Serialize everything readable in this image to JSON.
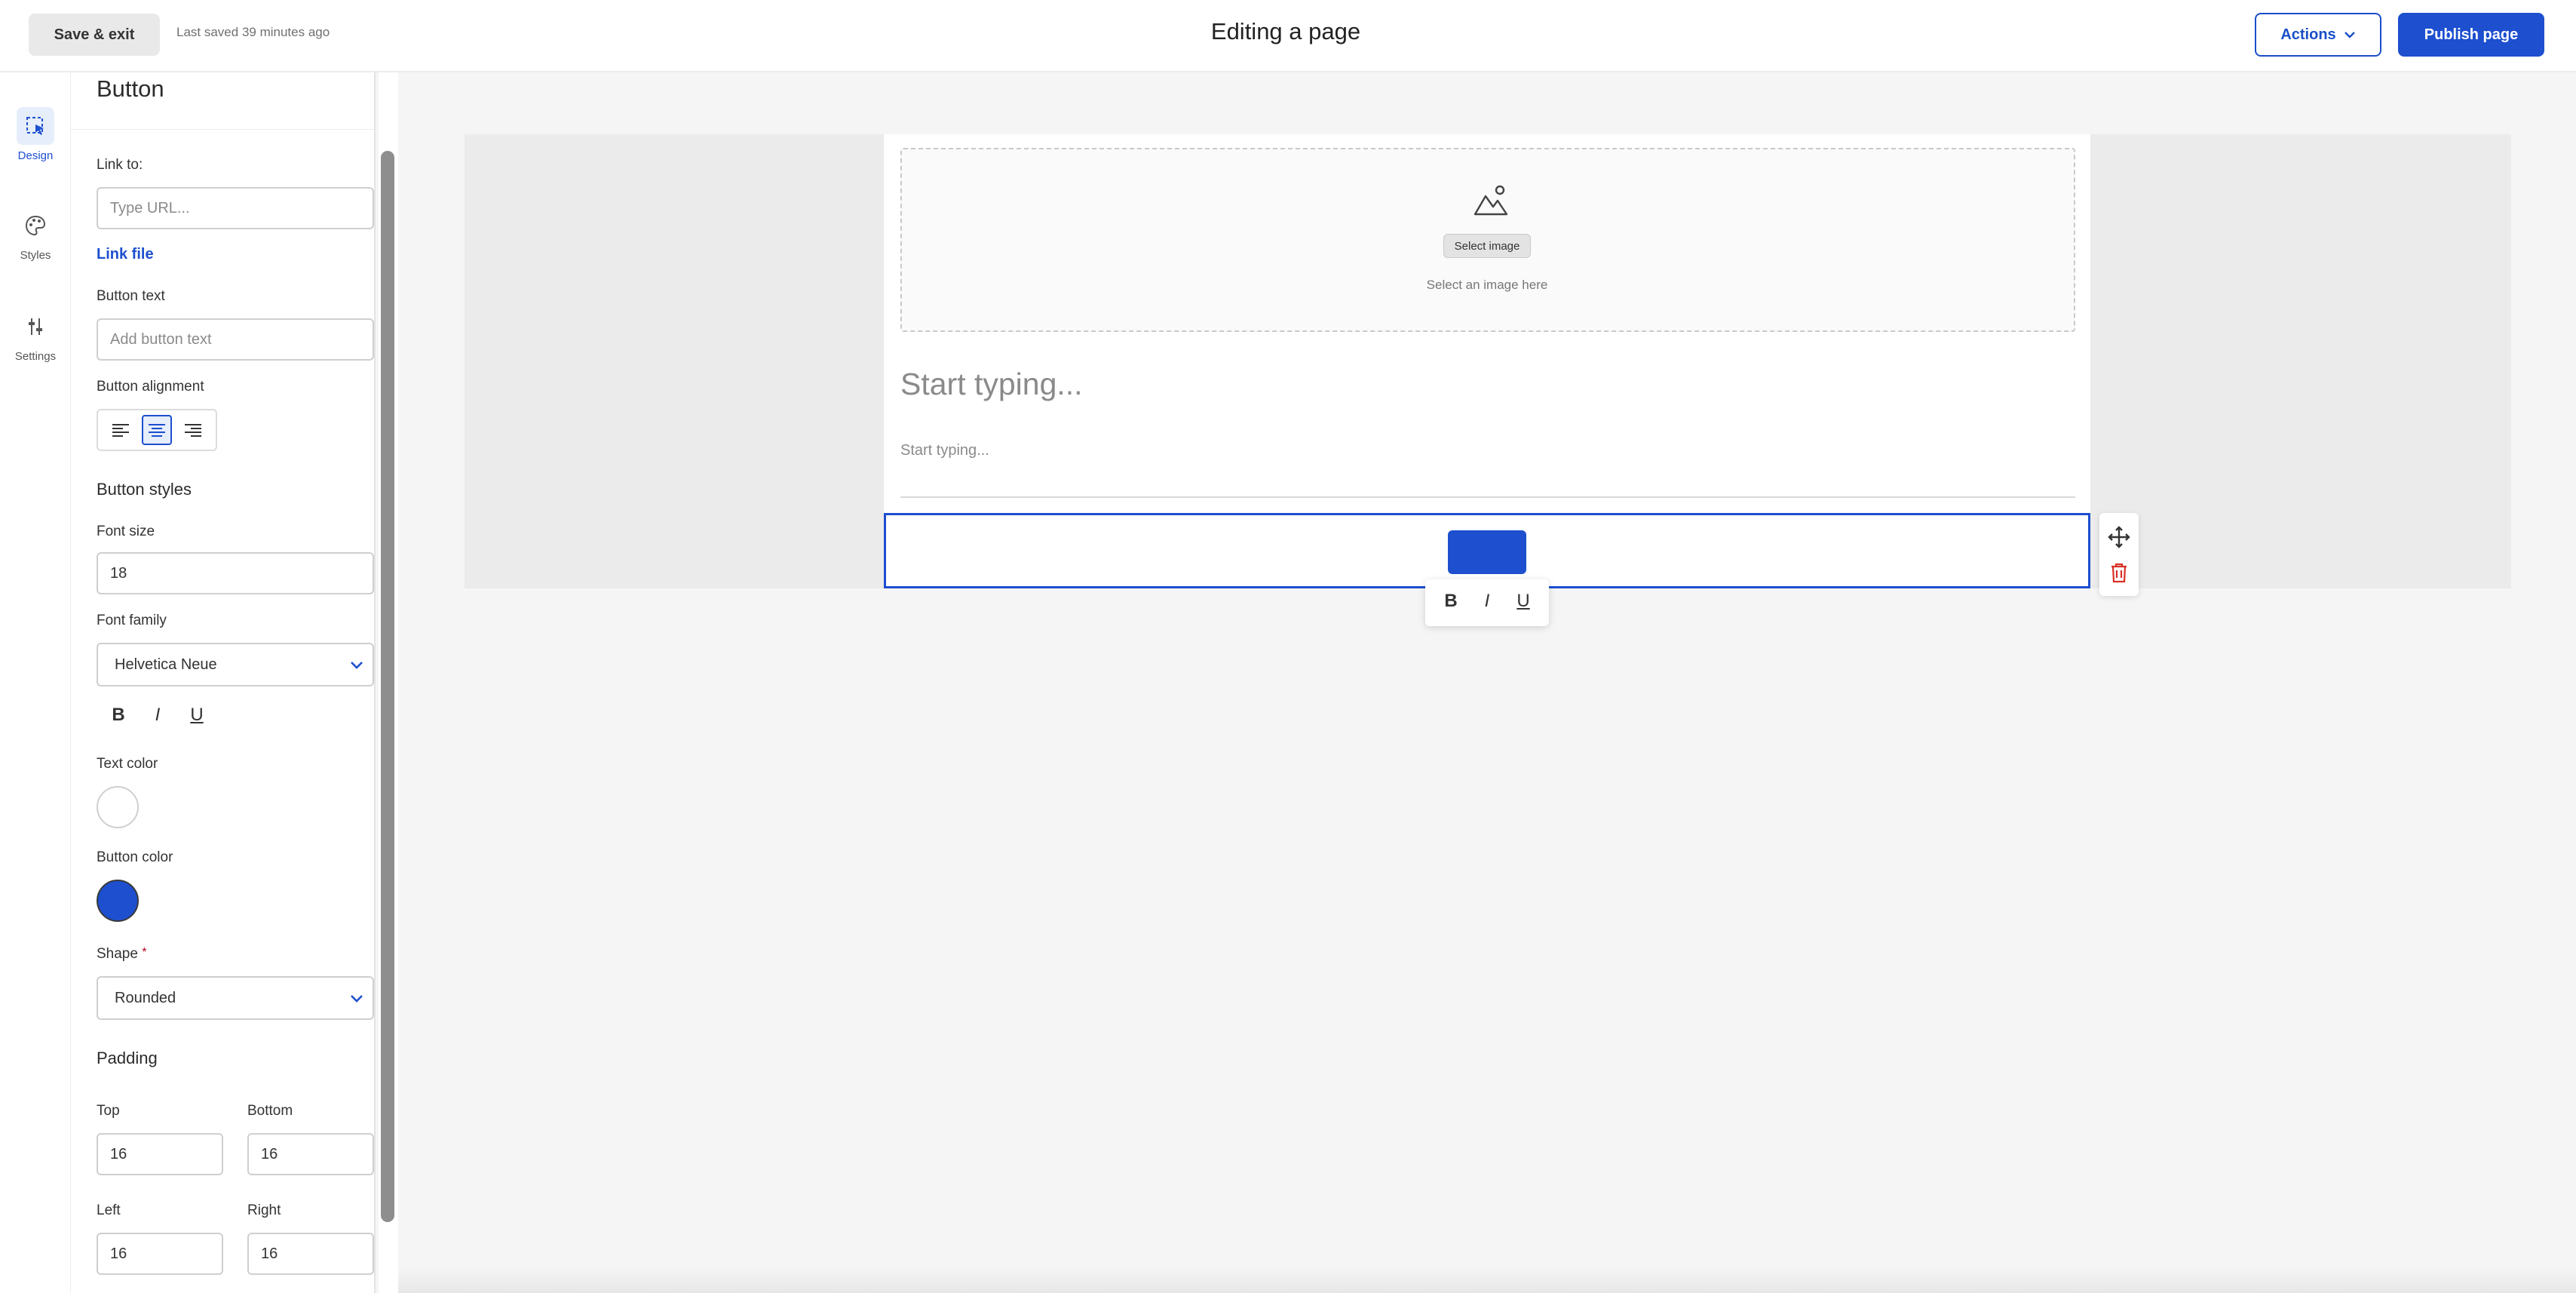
{
  "topbar": {
    "save_exit": "Save & exit",
    "last_saved": "Last saved 39 minutes ago",
    "title": "Editing a page",
    "actions": "Actions",
    "publish": "Publish page"
  },
  "rail": {
    "items": [
      {
        "label": "Design",
        "icon": "design-icon",
        "active": true
      },
      {
        "label": "Styles",
        "icon": "palette-icon",
        "active": false
      },
      {
        "label": "Settings",
        "icon": "sliders-icon",
        "active": false
      }
    ]
  },
  "panel": {
    "title": "Button",
    "link_to_label": "Link to:",
    "link_to_placeholder": "Type URL...",
    "link_file": "Link file",
    "button_text_label": "Button text",
    "button_text_placeholder": "Add button text",
    "alignment_label": "Button alignment",
    "alignment_selected": "center",
    "styles_title": "Button styles",
    "font_size_label": "Font size",
    "font_size_value": "18",
    "font_family_label": "Font family",
    "font_family_value": "Helvetica Neue",
    "format": {
      "bold": "B",
      "italic": "I",
      "underline": "U"
    },
    "text_color_label": "Text color",
    "text_color": "#ffffff",
    "button_color_label": "Button color",
    "button_color": "#1d4fcf",
    "shape_label": "Shape",
    "shape_required": "*",
    "shape_value": "Rounded",
    "padding_title": "Padding",
    "padding": {
      "top_label": "Top",
      "top": "16",
      "bottom_label": "Bottom",
      "bottom": "16",
      "left_label": "Left",
      "left": "16",
      "right_label": "Right",
      "right": "16"
    }
  },
  "canvas": {
    "select_image_button": "Select image",
    "select_image_hint": "Select an image here",
    "heading_placeholder": "Start typing...",
    "text_placeholder": "Start typing...",
    "format": {
      "bold": "B",
      "italic": "I",
      "underline": "U"
    }
  },
  "colors": {
    "accent": "#1d4fcf",
    "danger": "#d93025"
  }
}
